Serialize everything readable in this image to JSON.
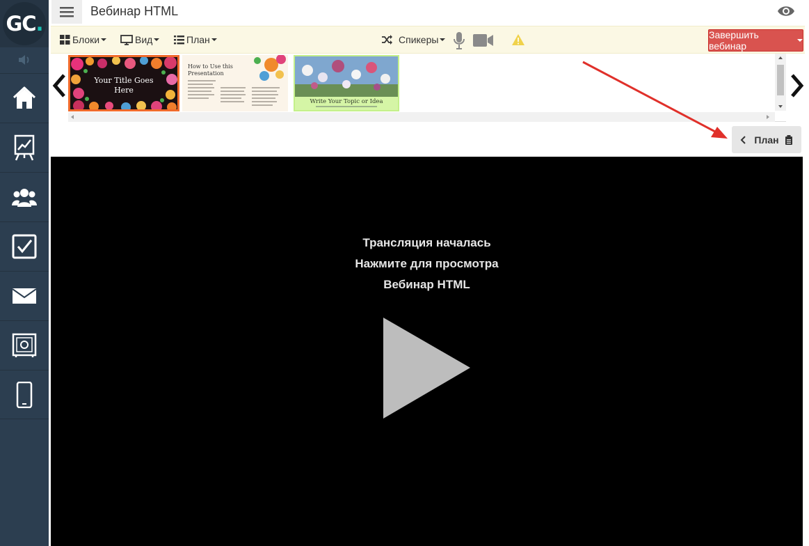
{
  "app": {
    "logo_letters": "GC",
    "logo_dot": ".",
    "window_title": "Вебинар HTML"
  },
  "sidebar": {
    "items": [
      {
        "icon": "home-icon"
      },
      {
        "icon": "presentation-chart-icon"
      },
      {
        "icon": "users-icon"
      },
      {
        "icon": "checkbox-icon"
      },
      {
        "icon": "envelope-icon"
      },
      {
        "icon": "safe-icon"
      },
      {
        "icon": "mobile-phone-icon"
      }
    ]
  },
  "toolbar": {
    "blocks_label": "Блоки",
    "view_label": "Вид",
    "plan_label": "План",
    "speakers_label": "Спикеры",
    "finish_label": "Завершить вебинар"
  },
  "slides": [
    {
      "title": "Your Title Goes Here"
    },
    {
      "title": "How to Use this Presentation"
    },
    {
      "title": "Write Your Topic or Idea"
    }
  ],
  "plan_button": {
    "label": "План"
  },
  "player": {
    "line1": "Трансляция началась",
    "line2": "Нажмите для просмотра",
    "line3": "Вебинар HTML"
  },
  "colors": {
    "sidebar_bg": "#2c3e50",
    "toolbar_bg": "#fbf8e4",
    "finish_button": "#d9534f",
    "annotation_arrow": "#e0302a"
  }
}
